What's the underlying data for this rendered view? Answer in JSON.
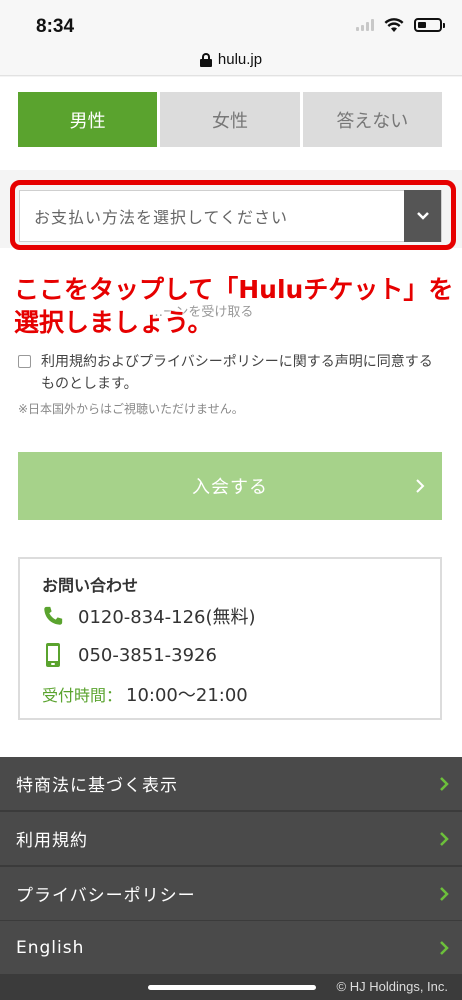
{
  "status_bar": {
    "time": "8:34"
  },
  "browser": {
    "url": "hulu.jp"
  },
  "gender": {
    "options": [
      "男性",
      "女性",
      "答えない"
    ],
    "selected": "男性"
  },
  "payment": {
    "placeholder": "お支払い方法を選択してください"
  },
  "instruction": {
    "line1": "ここをタップして「Huluチケット」を",
    "line2": "選択しましょう。"
  },
  "obscured_text": "…ーンを受け取る",
  "terms": {
    "checkbox_label": "利用規約およびプライバシーポリシーに関する声明に同意するものとします。",
    "note": "※日本国外からはご視聴いただけません。"
  },
  "join_button": {
    "label": "入会する"
  },
  "contact": {
    "title": "お問い合わせ",
    "phone_free": "0120-834-126(無料)",
    "phone_mobile": "050-3851-3926",
    "hours_label": "受付時間：",
    "hours_value": "10:00〜21:00"
  },
  "footer": {
    "items": [
      "特商法に基づく表示",
      "利用規約",
      "プライバシーポリシー",
      "English"
    ],
    "copyright": "© HJ Holdings, Inc."
  },
  "colors": {
    "brand_green": "#5aa32e",
    "light_green": "#a6d28a",
    "annotation_red": "#e60000",
    "footer_bg": "#4a4a4a"
  }
}
